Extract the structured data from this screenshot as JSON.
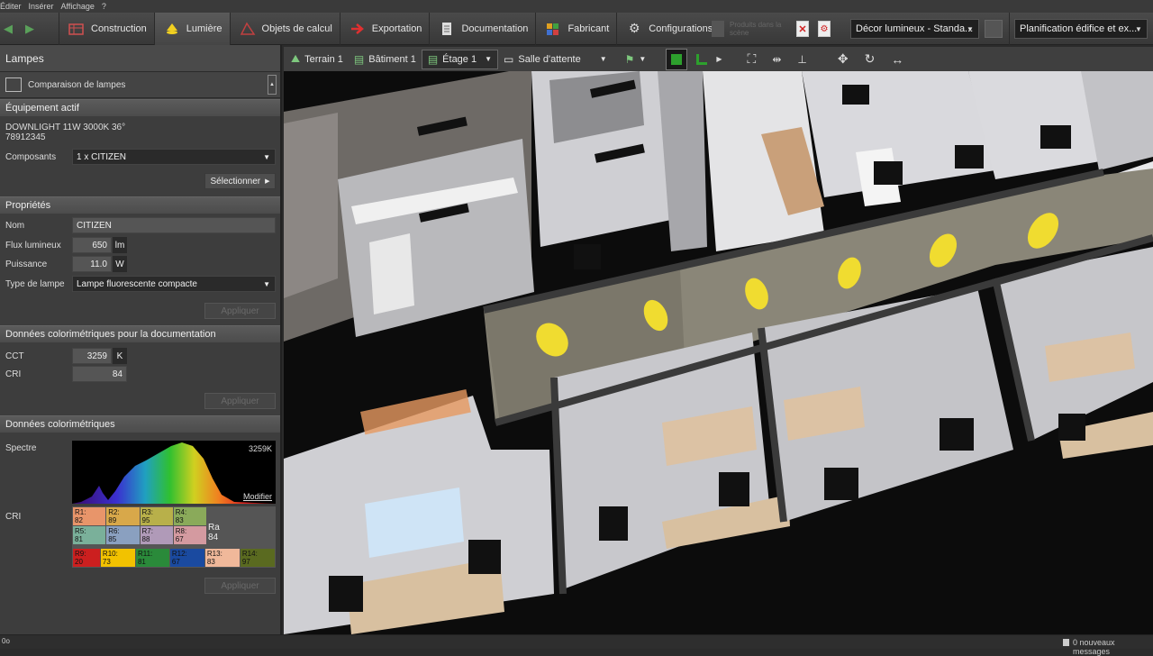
{
  "menu": [
    "Éditer",
    "Insérer",
    "Affichage",
    "?"
  ],
  "ribbon": {
    "tabs": [
      {
        "label": "Construction",
        "icon": "construction-icon"
      },
      {
        "label": "Lumière",
        "icon": "lamp-icon",
        "active": true
      },
      {
        "label": "Objets de calcul",
        "icon": "calculation-icon"
      },
      {
        "label": "Exportation",
        "icon": "export-icon"
      },
      {
        "label": "Documentation",
        "icon": "document-icon"
      },
      {
        "label": "Fabricant",
        "icon": "manufacturer-icon"
      },
      {
        "label": "Configurations",
        "icon": "gear-icon"
      }
    ],
    "disabled_btn": "Produits dans la scène",
    "scene_select": "Décor lumineux - Standa...",
    "plan_select": "Planification édifice et ex..."
  },
  "sidebar": {
    "title": "Lampes",
    "compare": "Comparaison de lampes",
    "equip_head": "Équipement actif",
    "equip_name": "DOWNLIGHT 11W 3000K 36°",
    "equip_code": "78912345",
    "comp_label": "Composants",
    "comp_value": "1 x CITIZEN",
    "select_btn": "Sélectionner",
    "props_head": "Propriétés",
    "name_label": "Nom",
    "name_value": "CITIZEN",
    "flux_label": "Flux lumineux",
    "flux_value": "650",
    "flux_unit": "lm",
    "power_label": "Puissance",
    "power_value": "11.0",
    "power_unit": "W",
    "type_label": "Type de lampe",
    "type_value": "Lampe fluorescente compacte",
    "apply": "Appliquer",
    "color_doc_head": "Données colorimétriques pour la documentation",
    "cct_label": "CCT",
    "cct_value": "3259",
    "cct_unit": "K",
    "cri_label": "CRI",
    "cri_value": "84",
    "color_head": "Données colorimétriques",
    "spectre_label": "Spectre",
    "spectre_temp": "3259K",
    "modifier": "Modifier",
    "cri2_label": "CRI",
    "ra_label": "Ra",
    "ra_value": "84",
    "cri_rows": [
      [
        {
          "k": "R1:",
          "v": "82",
          "c": "#e8956a"
        },
        {
          "k": "R2:",
          "v": "89",
          "c": "#d8a84a"
        },
        {
          "k": "R3:",
          "v": "95",
          "c": "#b8b04a"
        },
        {
          "k": "R4:",
          "v": "83",
          "c": "#8aaa5a"
        }
      ],
      [
        {
          "k": "R5:",
          "v": "81",
          "c": "#7ab09a"
        },
        {
          "k": "R6:",
          "v": "85",
          "c": "#8aa0c0"
        },
        {
          "k": "R7:",
          "v": "88",
          "c": "#b09ab8"
        },
        {
          "k": "R8:",
          "v": "67",
          "c": "#d49aa0"
        }
      ],
      [
        {
          "k": "R9:",
          "v": "20",
          "c": "#cc1f1f"
        },
        {
          "k": "R10:",
          "v": "73",
          "c": "#f2c200"
        },
        {
          "k": "R11:",
          "v": "81",
          "c": "#2a8a3a"
        },
        {
          "k": "R12:",
          "v": "67",
          "c": "#1a4aa0"
        },
        {
          "k": "R13:",
          "v": "83",
          "c": "#f0b89a"
        },
        {
          "k": "R14:",
          "v": "97",
          "c": "#5a6a20"
        }
      ]
    ]
  },
  "toolbar2": {
    "terrain": "Terrain 1",
    "batiment": "Bâtiment 1",
    "etage": "Étage 1",
    "salle": "Salle d'attente"
  },
  "status": {
    "messages": "0 nouveaux messages"
  }
}
